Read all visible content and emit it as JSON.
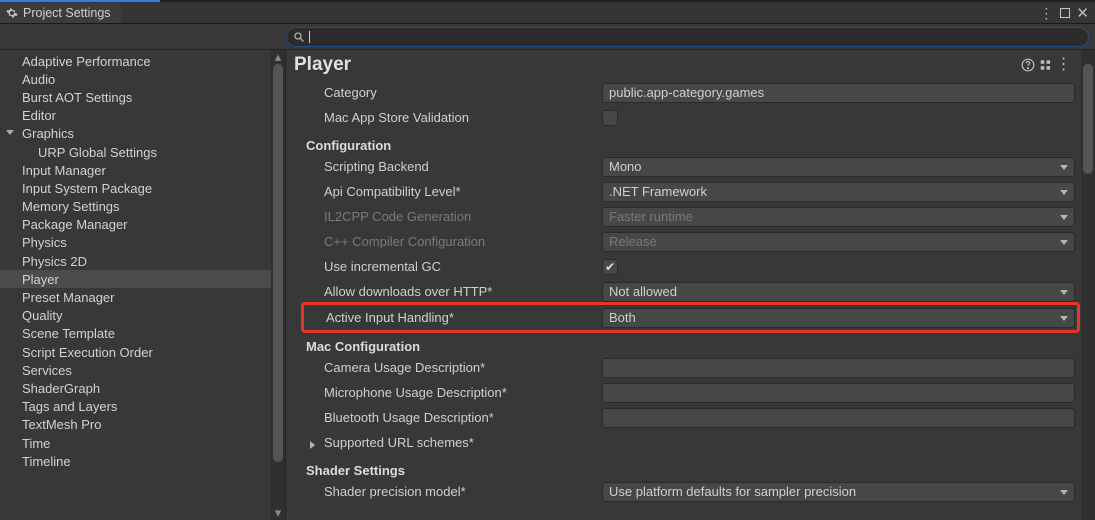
{
  "tab_title": "Project Settings",
  "search_value": "",
  "sidebar": {
    "items": [
      {
        "label": "Adaptive Performance",
        "level": 1,
        "selected": false,
        "expandable": false
      },
      {
        "label": "Audio",
        "level": 1,
        "selected": false,
        "expandable": false
      },
      {
        "label": "Burst AOT Settings",
        "level": 1,
        "selected": false,
        "expandable": false
      },
      {
        "label": "Editor",
        "level": 1,
        "selected": false,
        "expandable": false
      },
      {
        "label": "Graphics",
        "level": 1,
        "selected": false,
        "expandable": true
      },
      {
        "label": "URP Global Settings",
        "level": 2,
        "selected": false,
        "expandable": false
      },
      {
        "label": "Input Manager",
        "level": 1,
        "selected": false,
        "expandable": false
      },
      {
        "label": "Input System Package",
        "level": 1,
        "selected": false,
        "expandable": false
      },
      {
        "label": "Memory Settings",
        "level": 1,
        "selected": false,
        "expandable": false
      },
      {
        "label": "Package Manager",
        "level": 1,
        "selected": false,
        "expandable": false
      },
      {
        "label": "Physics",
        "level": 1,
        "selected": false,
        "expandable": false
      },
      {
        "label": "Physics 2D",
        "level": 1,
        "selected": false,
        "expandable": false
      },
      {
        "label": "Player",
        "level": 1,
        "selected": true,
        "expandable": false
      },
      {
        "label": "Preset Manager",
        "level": 1,
        "selected": false,
        "expandable": false
      },
      {
        "label": "Quality",
        "level": 1,
        "selected": false,
        "expandable": false
      },
      {
        "label": "Scene Template",
        "level": 1,
        "selected": false,
        "expandable": false
      },
      {
        "label": "Script Execution Order",
        "level": 1,
        "selected": false,
        "expandable": false
      },
      {
        "label": "Services",
        "level": 1,
        "selected": false,
        "expandable": false
      },
      {
        "label": "ShaderGraph",
        "level": 1,
        "selected": false,
        "expandable": false
      },
      {
        "label": "Tags and Layers",
        "level": 1,
        "selected": false,
        "expandable": false
      },
      {
        "label": "TextMesh Pro",
        "level": 1,
        "selected": false,
        "expandable": false
      },
      {
        "label": "Time",
        "level": 1,
        "selected": false,
        "expandable": false
      },
      {
        "label": "Timeline",
        "level": 1,
        "selected": false,
        "expandable": false
      }
    ]
  },
  "main": {
    "title": "Player",
    "rows": {
      "category_label": "Category",
      "category_value": "public.app-category.games",
      "macstore_label": "Mac App Store Validation",
      "macstore_checked": false,
      "configuration_head": "Configuration",
      "scripting_backend_label": "Scripting Backend",
      "scripting_backend_value": "Mono",
      "api_compat_label": "Api Compatibility Level*",
      "api_compat_value": ".NET Framework",
      "il2cpp_label": "IL2CPP Code Generation",
      "il2cpp_value": "Faster runtime",
      "cpp_compiler_label": "C++ Compiler Configuration",
      "cpp_compiler_value": "Release",
      "inc_gc_label": "Use incremental GC",
      "inc_gc_checked": true,
      "http_label": "Allow downloads over HTTP*",
      "http_value": "Not allowed",
      "active_input_label": "Active Input Handling*",
      "active_input_value": "Both",
      "mac_config_head": "Mac Configuration",
      "camera_desc_label": "Camera Usage Description*",
      "camera_desc_value": "",
      "mic_desc_label": "Microphone Usage Description*",
      "mic_desc_value": "",
      "bt_desc_label": "Bluetooth Usage Description*",
      "bt_desc_value": "",
      "url_schemes_label": "Supported URL schemes*",
      "shader_head": "Shader Settings",
      "shader_precision_label": "Shader precision model*",
      "shader_precision_value": "Use platform defaults for sampler precision"
    }
  }
}
